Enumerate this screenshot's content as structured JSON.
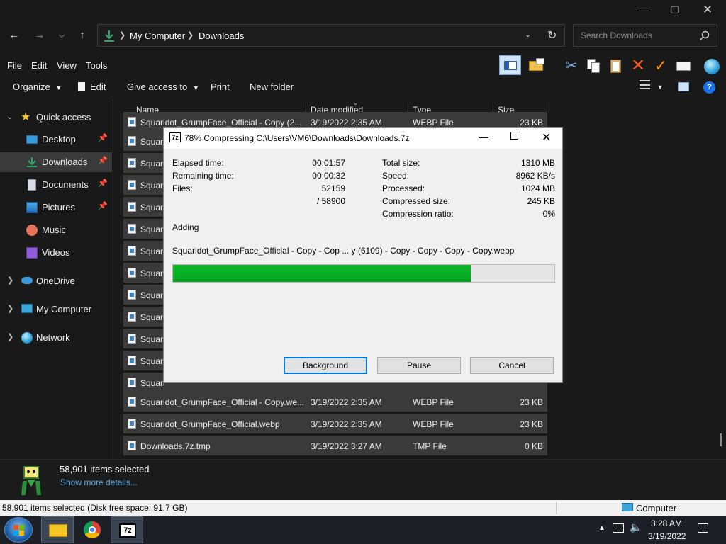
{
  "explorer": {
    "address": {
      "root": "My Computer",
      "folder": "Downloads"
    },
    "search_placeholder": "Search Downloads",
    "menu": [
      "File",
      "Edit",
      "View",
      "Tools"
    ],
    "commands": {
      "organize": "Organize",
      "edit": "Edit",
      "give_access": "Give access to",
      "print": "Print",
      "new_folder": "New folder"
    },
    "columns": {
      "name": "Name",
      "date": "Date modified",
      "type": "Type",
      "size": "Size"
    },
    "nav": {
      "quick_access": "Quick access",
      "desktop": "Desktop",
      "downloads": "Downloads",
      "documents": "Documents",
      "pictures": "Pictures",
      "music": "Music",
      "videos": "Videos",
      "onedrive": "OneDrive",
      "my_computer": "My Computer",
      "network": "Network"
    },
    "files": [
      {
        "name": "Squaridot_GrumpFace_Official - Copy (2...",
        "date": "3/19/2022 2:35 AM",
        "type": "WEBP File",
        "size": "23 KB"
      },
      {
        "name": "Squari"
      },
      {
        "name": "Squari"
      },
      {
        "name": "Squari"
      },
      {
        "name": "Squari"
      },
      {
        "name": "Squari"
      },
      {
        "name": "Squari"
      },
      {
        "name": "Squari"
      },
      {
        "name": "Squari"
      },
      {
        "name": "Squari"
      },
      {
        "name": "Squari"
      },
      {
        "name": "Squari"
      },
      {
        "name": "Squari"
      },
      {
        "name": "Squaridot_GrumpFace_Official - Copy.we...",
        "date": "3/19/2022 2:35 AM",
        "type": "WEBP File",
        "size": "23 KB"
      },
      {
        "name": "Squaridot_GrumpFace_Official.webp",
        "date": "3/19/2022 2:35 AM",
        "type": "WEBP File",
        "size": "23 KB"
      },
      {
        "name": "Downloads.7z.tmp",
        "date": "3/19/2022 3:27 AM",
        "type": "TMP File",
        "size": "0 KB"
      }
    ],
    "details": {
      "selected": "58,901 items selected",
      "more": "Show more details..."
    },
    "status": {
      "left": "58,901 items selected (Disk free space: 91.7 GB)",
      "right": "Computer"
    }
  },
  "dialog": {
    "title": "78% Compressing C:\\Users\\VM6\\Downloads\\Downloads.7z",
    "icon_text": "7z",
    "left_labels": [
      "Elapsed time:",
      "Remaining time:",
      "Files:"
    ],
    "left_values": [
      "00:01:57",
      "00:00:32",
      "52159",
      "/ 58900"
    ],
    "right_labels": [
      "Total size:",
      "Speed:",
      "Processed:",
      "Compressed size:",
      "Compression ratio:"
    ],
    "right_values": [
      "1310 MB",
      "8962 KB/s",
      "1024 MB",
      "245 KB",
      "0%"
    ],
    "action": "Adding",
    "current_file": "Squaridot_GrumpFace_Official - Copy - Cop ... y (6109) - Copy - Copy - Copy - Copy.webp",
    "progress": 0.78,
    "buttons": {
      "background": "Background",
      "pause": "Pause",
      "cancel": "Cancel"
    }
  },
  "taskbar": {
    "time": "3:28 AM",
    "date": "3/19/2022",
    "sevenzip": "7z"
  },
  "colors": {
    "progress_green": "#06b025",
    "explorer_bg": "#191919",
    "selected_row": "#3a3a3a",
    "accent": "#2c8c5a"
  }
}
